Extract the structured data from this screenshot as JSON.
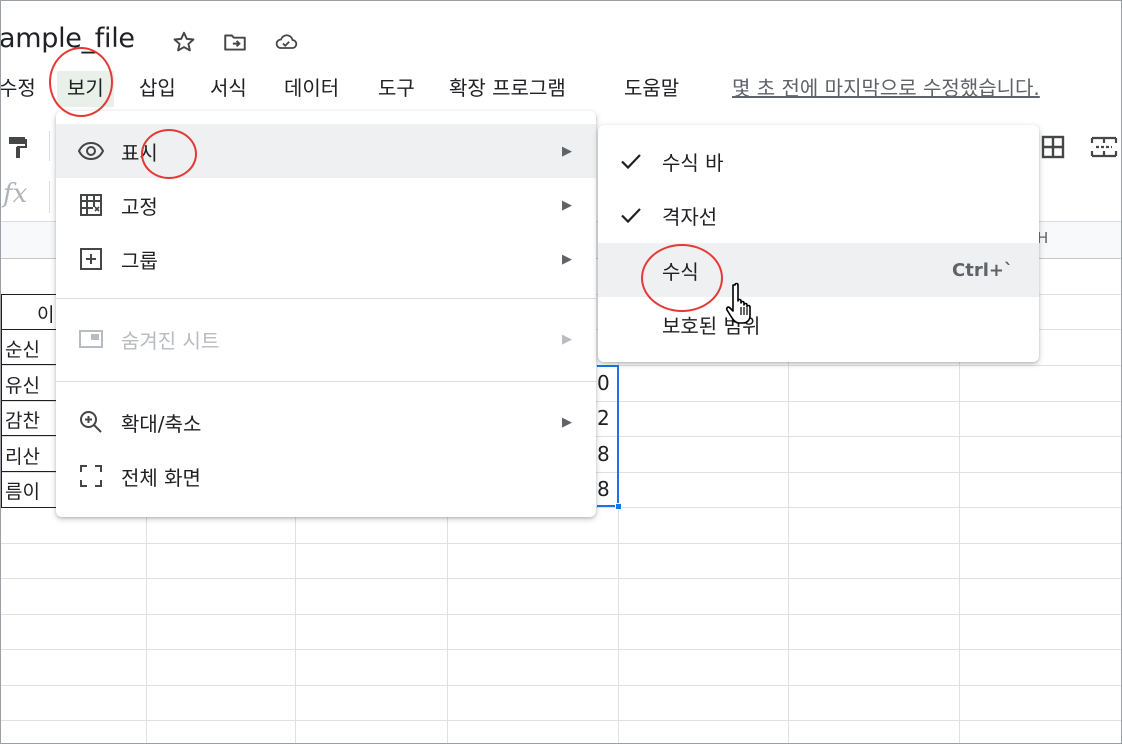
{
  "title": "ample_file",
  "title_icons": [
    "star-icon",
    "move-to-folder-icon",
    "cloud-status-icon"
  ],
  "menubar": {
    "items": [
      {
        "label": "수정",
        "name": "edit"
      },
      {
        "label": "보기",
        "name": "view"
      },
      {
        "label": "삽입",
        "name": "insert"
      },
      {
        "label": "서식",
        "name": "format"
      },
      {
        "label": "데이터",
        "name": "data"
      },
      {
        "label": "도구",
        "name": "tools"
      },
      {
        "label": "확장 프로그램",
        "name": "extensions"
      },
      {
        "label": "도움말",
        "name": "help"
      }
    ],
    "last_edit": "몇 초 전에 마지막으로 수정했습니다."
  },
  "formula_bar": {
    "fx": "fx"
  },
  "grid": {
    "visible_column_letter": "H",
    "left_cells": [
      "이",
      "순신",
      "유신",
      "감찬",
      "리산",
      "름이"
    ],
    "right_values": [
      "0",
      "2",
      "8",
      "8"
    ]
  },
  "view_menu": {
    "items": [
      {
        "label": "표시",
        "icon": "eye-icon",
        "has_submenu": true,
        "state": "hover"
      },
      {
        "label": "고정",
        "icon": "freeze-grid-icon",
        "has_submenu": true,
        "state": "normal"
      },
      {
        "label": "그룹",
        "icon": "group-plus-box-icon",
        "has_submenu": true,
        "state": "normal"
      },
      {
        "label": "숨겨진 시트",
        "icon": "hidden-sheet-icon",
        "has_submenu": true,
        "state": "disabled"
      },
      {
        "label": "확대/축소",
        "icon": "zoom-in-icon",
        "has_submenu": true,
        "state": "normal"
      },
      {
        "label": "전체 화면",
        "icon": "fullscreen-icon",
        "has_submenu": false,
        "state": "normal"
      }
    ]
  },
  "show_submenu": {
    "items": [
      {
        "label": "수식 바",
        "checked": true,
        "shortcut": ""
      },
      {
        "label": "격자선",
        "checked": true,
        "shortcut": ""
      },
      {
        "label": "수식",
        "checked": false,
        "shortcut": "Ctrl+`",
        "state": "hover"
      },
      {
        "label": "보호된 범위",
        "checked": false,
        "shortcut": ""
      }
    ]
  },
  "colors": {
    "accent": "#1a73e8",
    "annotation": "#e53935",
    "hover": "#eef0f2"
  }
}
